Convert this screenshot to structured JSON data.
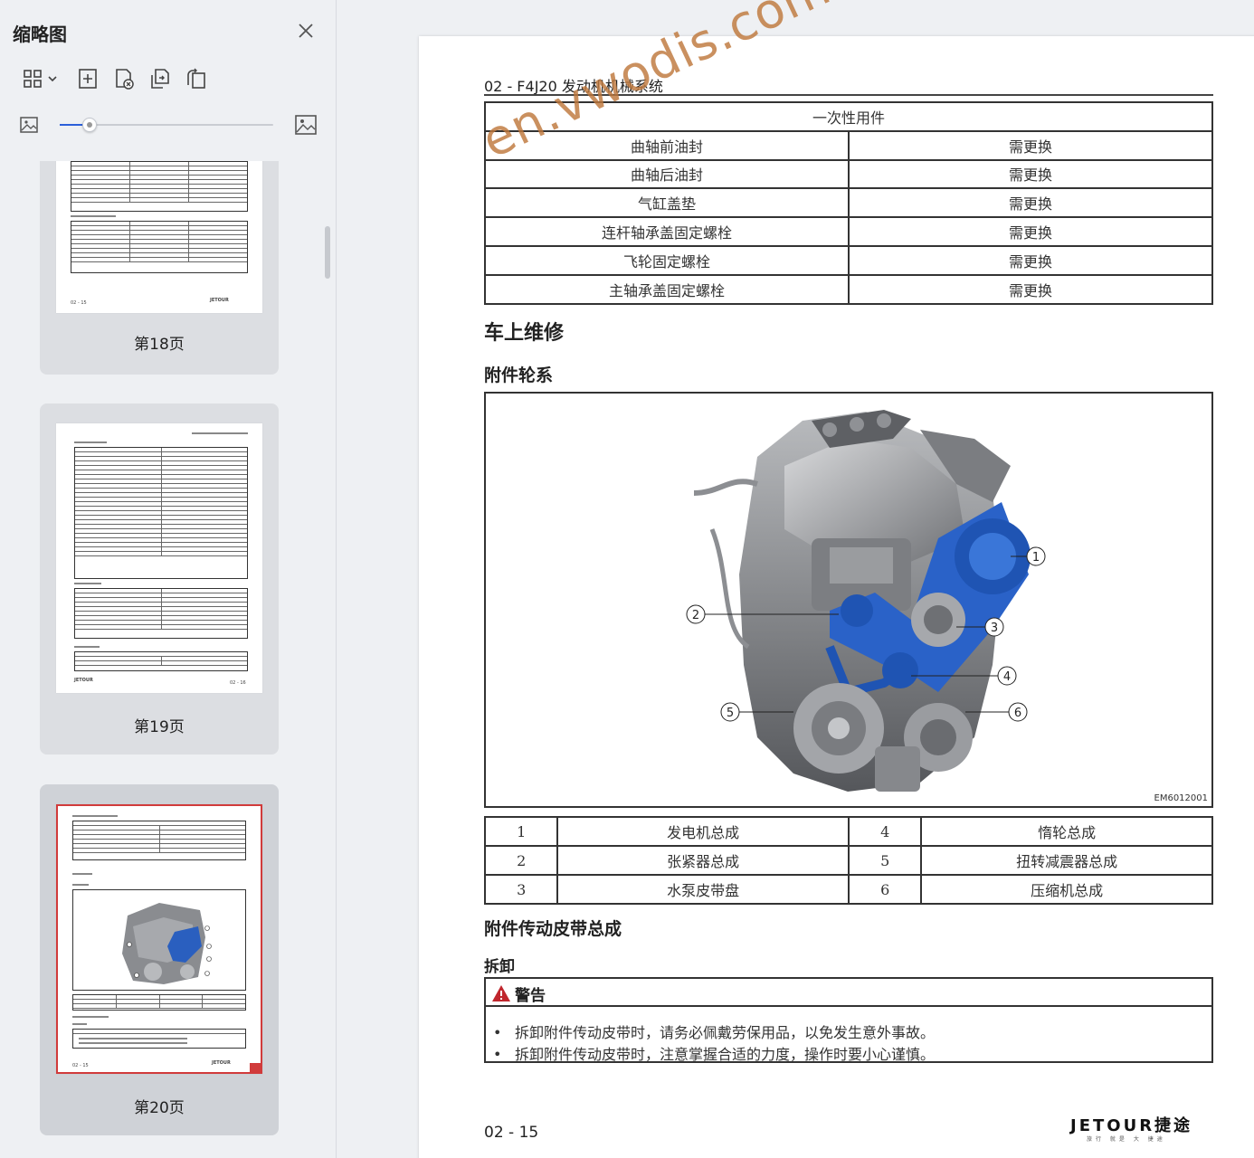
{
  "sidebar": {
    "title": "缩略图",
    "toolbar": {
      "view_icon": "grid-view-icon",
      "add_icon": "add-page-icon",
      "delete_icon": "delete-page-icon",
      "extract_icon": "extract-page-icon",
      "rotate_icon": "rotate-page-icon"
    },
    "zoom": {
      "level": 0.14
    },
    "pages": [
      {
        "label": "第18页",
        "footer_left": "02 - 15",
        "footer_right": "JETOUR"
      },
      {
        "label": "第19页",
        "footer_left": "JETOUR",
        "footer_right": "02 - 16"
      },
      {
        "label": "第20页",
        "footer_left": "02 - 15",
        "footer_right": "JETOUR",
        "active": true
      }
    ]
  },
  "document": {
    "header": "02 - F4J20 发动机机械系统",
    "disposable_table": {
      "title": "一次性用件",
      "rows": [
        [
          "曲轴前油封",
          "需更换"
        ],
        [
          "曲轴后油封",
          "需更换"
        ],
        [
          "气缸盖垫",
          "需更换"
        ],
        [
          "连杆轴承盖固定螺栓",
          "需更换"
        ],
        [
          "飞轮固定螺栓",
          "需更换"
        ],
        [
          "主轴承盖固定螺栓",
          "需更换"
        ]
      ]
    },
    "section_on_vehicle": "车上维修",
    "section_accessory": "附件轮系",
    "figure": {
      "code": "EM6012001",
      "watermark": "en.vwodis.com",
      "callouts": [
        "1",
        "2",
        "3",
        "4",
        "5",
        "6"
      ]
    },
    "legend_table": [
      [
        "1",
        "发电机总成",
        "4",
        "惰轮总成"
      ],
      [
        "2",
        "张紧器总成",
        "5",
        "扭转减震器总成"
      ],
      [
        "3",
        "水泵皮带盘",
        "6",
        "压缩机总成"
      ]
    ],
    "section_belt": "附件传动皮带总成",
    "section_remove": "拆卸",
    "warning": {
      "title": "警告",
      "items": [
        "拆卸附件传动皮带时，请务必佩戴劳保用品，以免发生意外事故。",
        "拆卸附件传动皮带时，注意掌握合适的力度，操作时要小心谨慎。"
      ]
    },
    "page_number": "02 - 15",
    "brand": {
      "name": "JETOUR捷途",
      "tagline": "旅行 就是 大 捷途"
    }
  }
}
